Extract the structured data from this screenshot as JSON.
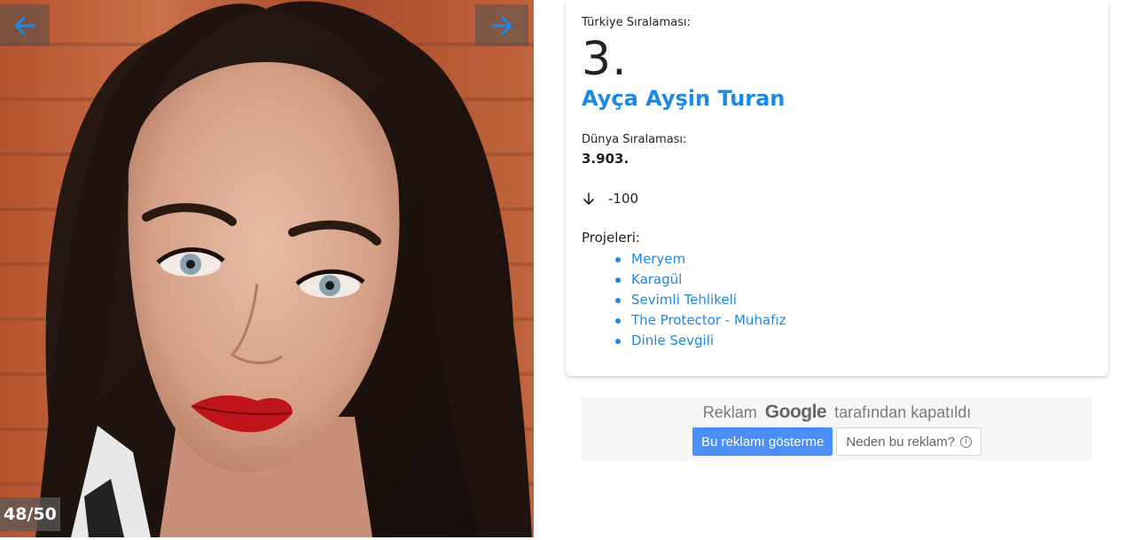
{
  "gallery": {
    "counter": "48/50",
    "prev_icon": "arrow-left-icon",
    "next_icon": "arrow-right-icon",
    "arrow_color": "#1e88e5"
  },
  "profile": {
    "turkey_rank_label": "Türkiye Sıralaması:",
    "turkey_rank": "3.",
    "name": "Ayça Ayşin Turan",
    "world_rank_label": "Dünya Sıralaması:",
    "world_rank": "3.903.",
    "change_icon": "arrow-down-icon",
    "change_value": "-100",
    "projects_label": "Projeleri:",
    "projects": [
      "Meryem",
      "Karagül",
      "Sevimli Tehlikeli",
      "The Protector - Muhafız",
      "Dinle Sevgili"
    ]
  },
  "ad": {
    "prefix": "Reklam",
    "brand": "Google",
    "suffix": "tarafından kapatıldı",
    "stop_button": "Bu reklamı gösterme",
    "why_button": "Neden bu reklam?",
    "info_icon": "info-icon"
  },
  "colors": {
    "link": "#1e88e5",
    "ad_primary": "#4a8ff7"
  }
}
